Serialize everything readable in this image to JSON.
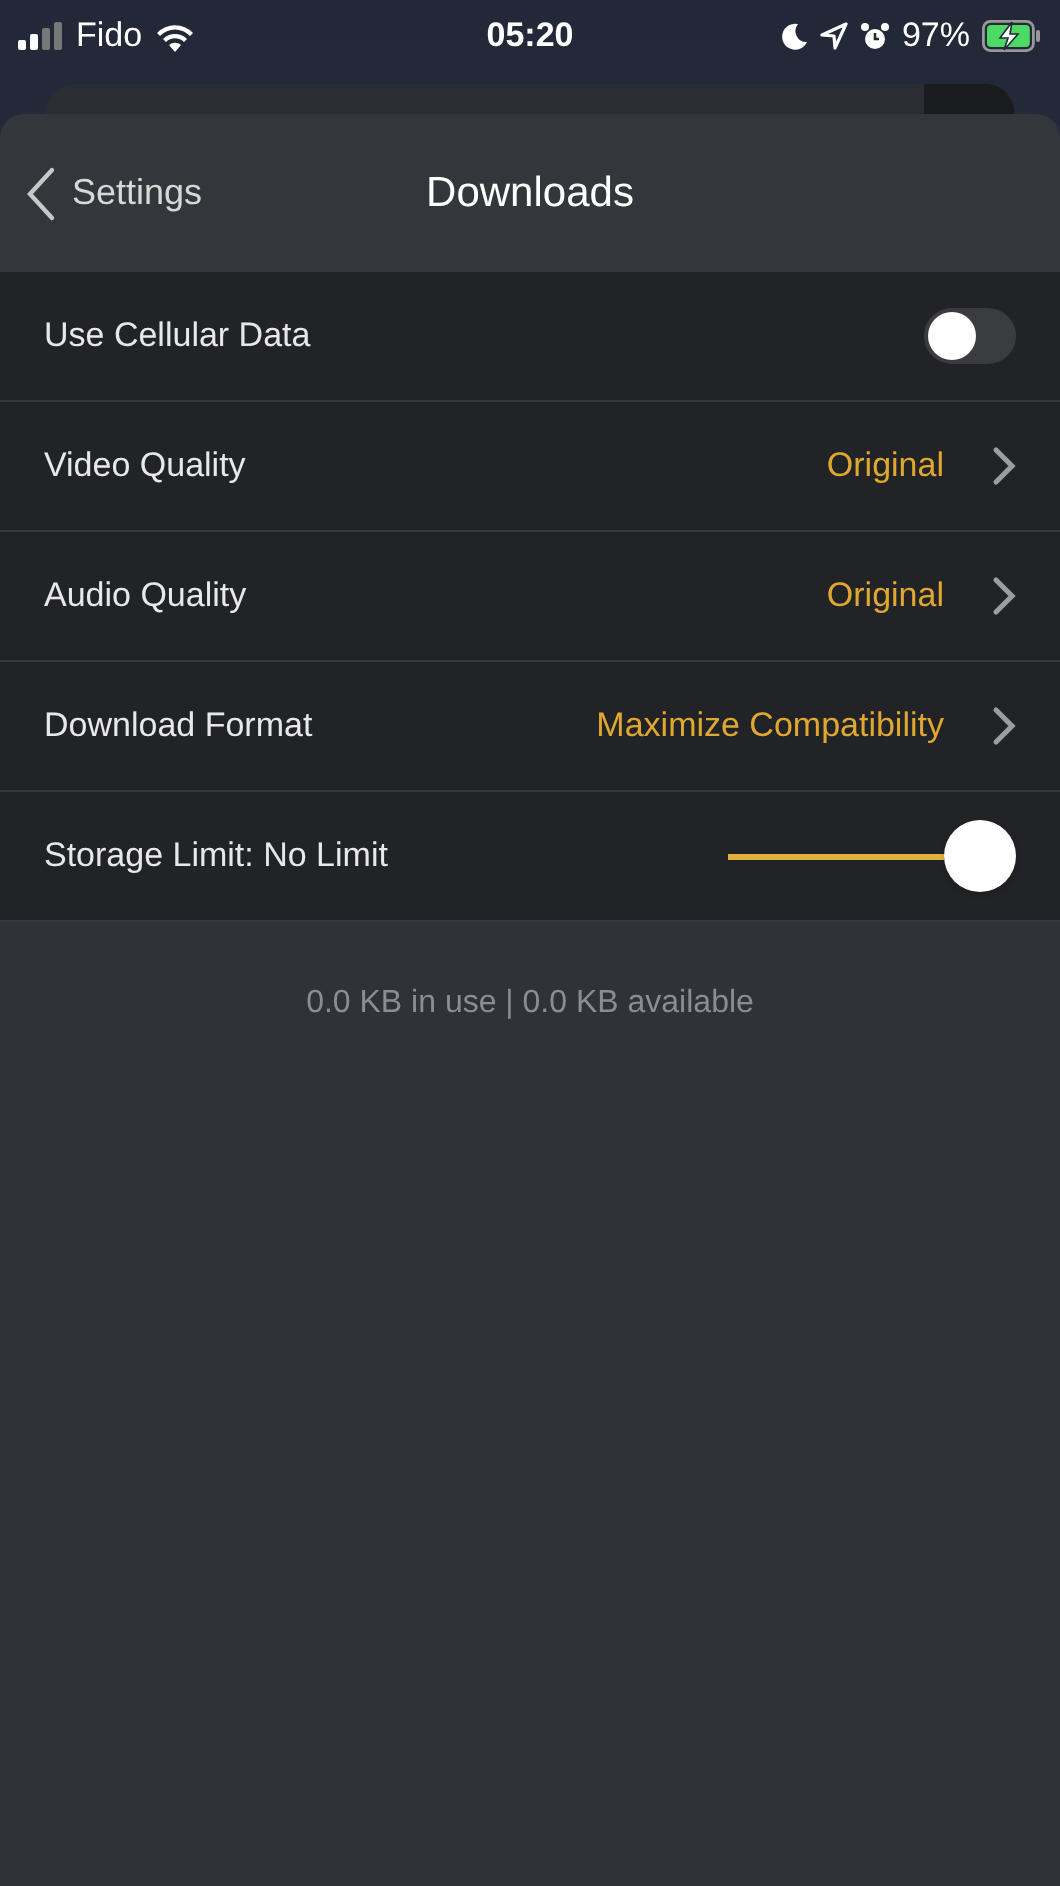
{
  "status_bar": {
    "carrier": "Fido",
    "time": "05:20",
    "battery": "97%"
  },
  "nav": {
    "back": "Settings",
    "title": "Downloads"
  },
  "rows": [
    {
      "kind": "toggle",
      "label": "Use Cellular Data",
      "on": false
    },
    {
      "kind": "link",
      "label": "Video Quality",
      "value": "Original"
    },
    {
      "kind": "link",
      "label": "Audio Quality",
      "value": "Original"
    },
    {
      "kind": "link",
      "label": "Download Format",
      "value": "Maximize Compatibility"
    },
    {
      "kind": "slider",
      "label": "Storage Limit: No Limit",
      "level": 1
    }
  ],
  "footer": "0.0 KB in use | 0.0 KB available"
}
